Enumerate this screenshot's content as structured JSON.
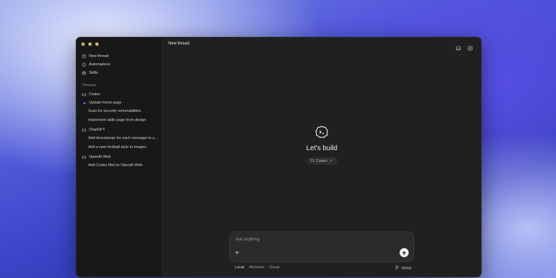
{
  "sidebar": {
    "nav": [
      {
        "label": "New thread",
        "icon": "edit-icon"
      },
      {
        "label": "Automations",
        "icon": "clock-icon"
      },
      {
        "label": "Skills",
        "icon": "package-icon"
      }
    ],
    "threads_label": "Threads",
    "folders": [
      {
        "name": "Codex",
        "threads": [
          "Update home page",
          "Scan for security vulnerabilities",
          "Implement skills page from design"
        ]
      },
      {
        "name": "ChatGPT",
        "threads": [
          "Add timestamps for each message to u...",
          "Add a new football style to images"
        ]
      },
      {
        "name": "OpenAI Web",
        "threads": [
          "Add Codex Mini to OpenAI Web"
        ]
      }
    ],
    "active_thread": "Update home page",
    "active_color": "#4a74ff"
  },
  "main": {
    "title": "New thread",
    "headline": "Let's build",
    "project_chip": "Codex",
    "composer": {
      "placeholder": "Ask anything",
      "add_label": "+",
      "send_icon": "arrow-up-icon"
    },
    "environments": [
      "Local",
      "Worktree",
      "Cloud"
    ],
    "selected_environment": "Local",
    "branch": "ebjagi"
  }
}
